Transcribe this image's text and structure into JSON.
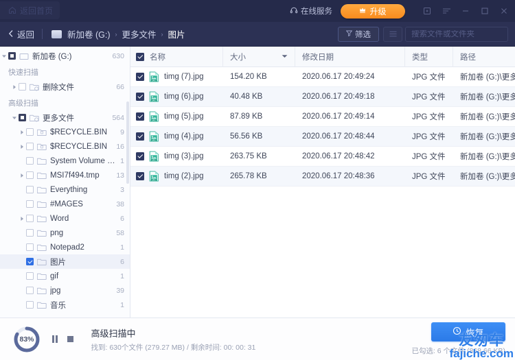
{
  "titlebar": {
    "home_label": "返回首页",
    "home_icon": "home-icon",
    "online_service_label": "在线服务",
    "online_service_icon": "headset-icon",
    "upgrade_label": "升级",
    "upgrade_icon": "crown-icon",
    "window_icons": [
      "feedback-icon",
      "menu-icon",
      "minimize-icon",
      "maximize-icon",
      "close-icon"
    ]
  },
  "breadcrumb": {
    "back_label": "返回",
    "back_icon": "chevron-left-icon",
    "drive_icon": "drive-icon",
    "items": [
      "新加卷 (G:)",
      "更多文件",
      "图片"
    ],
    "separator": "›"
  },
  "toolbar": {
    "filter_label": "筛选",
    "filter_icon": "funnel-icon",
    "view_icon": "list-view-icon",
    "search_placeholder": "搜索文件或文件夹",
    "search_value": "",
    "search_icon": "search-icon"
  },
  "sidebar": {
    "root": {
      "label": "新加卷 (G:)",
      "count": "630",
      "checkstate": "partial",
      "expanded": true
    },
    "groups": [
      {
        "title": "快速扫描",
        "items": [
          {
            "label": "删除文件",
            "count": "66",
            "checkstate": "none",
            "twisty": "collapsed",
            "indent": 1,
            "icon": "folder-deleted-icon"
          }
        ]
      },
      {
        "title": "高级扫描",
        "items": [
          {
            "label": "更多文件",
            "count": "564",
            "checkstate": "partial",
            "twisty": "expanded",
            "indent": 1,
            "icon": "folder-search-icon"
          },
          {
            "label": "$RECYCLE.BIN",
            "count": "9",
            "checkstate": "none",
            "twisty": "collapsed",
            "indent": 2,
            "icon": "folder-recycle-icon"
          },
          {
            "label": "$RECYCLE.BIN",
            "count": "16",
            "checkstate": "none",
            "twisty": "collapsed",
            "indent": 2,
            "icon": "folder-recycle-icon"
          },
          {
            "label": "System Volume Inf...",
            "count": "1",
            "checkstate": "none",
            "twisty": "none",
            "indent": 2,
            "icon": "folder-icon"
          },
          {
            "label": "MSI7f494.tmp",
            "count": "13",
            "checkstate": "none",
            "twisty": "collapsed",
            "indent": 2,
            "icon": "folder-icon"
          },
          {
            "label": "Everything",
            "count": "3",
            "checkstate": "none",
            "twisty": "none",
            "indent": 2,
            "icon": "folder-icon"
          },
          {
            "label": "#MAGES",
            "count": "38",
            "checkstate": "none",
            "twisty": "none",
            "indent": 2,
            "icon": "folder-icon"
          },
          {
            "label": "Word",
            "count": "6",
            "checkstate": "none",
            "twisty": "collapsed",
            "indent": 2,
            "icon": "folder-icon"
          },
          {
            "label": "png",
            "count": "58",
            "checkstate": "none",
            "twisty": "none",
            "indent": 2,
            "icon": "folder-icon"
          },
          {
            "label": "Notepad2",
            "count": "1",
            "checkstate": "none",
            "twisty": "none",
            "indent": 2,
            "icon": "folder-icon"
          },
          {
            "label": "图片",
            "count": "6",
            "checkstate": "checked",
            "twisty": "none",
            "indent": 2,
            "icon": "folder-icon",
            "selected": true
          },
          {
            "label": "gif",
            "count": "1",
            "checkstate": "none",
            "twisty": "none",
            "indent": 2,
            "icon": "folder-icon"
          },
          {
            "label": "jpg",
            "count": "39",
            "checkstate": "none",
            "twisty": "none",
            "indent": 2,
            "icon": "folder-icon"
          },
          {
            "label": "音乐",
            "count": "1",
            "checkstate": "none",
            "twisty": "none",
            "indent": 2,
            "icon": "folder-icon"
          }
        ]
      }
    ]
  },
  "table": {
    "columns": [
      "名称",
      "大小",
      "修改日期",
      "类型",
      "路径"
    ],
    "sort_column": "大小",
    "sort_icon": "caret-down-icon",
    "header_checked": true,
    "rows": [
      {
        "name": "timg (7).jpg",
        "size": "154.20 KB",
        "date": "2020.06.17 20:49:24",
        "type": "JPG 文件",
        "path": "新加卷 (G:)\\更多文件...",
        "checked": true
      },
      {
        "name": "timg (6).jpg",
        "size": "40.48 KB",
        "date": "2020.06.17 20:49:18",
        "type": "JPG 文件",
        "path": "新加卷 (G:)\\更多文件...",
        "checked": true
      },
      {
        "name": "timg (5).jpg",
        "size": "87.89 KB",
        "date": "2020.06.17 20:49:14",
        "type": "JPG 文件",
        "path": "新加卷 (G:)\\更多文件...",
        "checked": true
      },
      {
        "name": "timg (4).jpg",
        "size": "56.56 KB",
        "date": "2020.06.17 20:48:44",
        "type": "JPG 文件",
        "path": "新加卷 (G:)\\更多文件...",
        "checked": true
      },
      {
        "name": "timg (3).jpg",
        "size": "263.75 KB",
        "date": "2020.06.17 20:48:42",
        "type": "JPG 文件",
        "path": "新加卷 (G:)\\更多文件...",
        "checked": true
      },
      {
        "name": "timg (2).jpg",
        "size": "265.78 KB",
        "date": "2020.06.17 20:48:36",
        "type": "JPG 文件",
        "path": "新加卷 (G:)\\更多文件...",
        "checked": true
      }
    ]
  },
  "footer": {
    "progress_percent": 83,
    "progress_label": "83%",
    "pause_icon": "pause-icon",
    "stop_icon": "stop-icon",
    "scan_title": "高级扫描中",
    "scan_detail": "找到: 630个文件 (279.27 MB) / 剩余时间:  00: 00: 31",
    "recover_label": "恢复",
    "recover_icon": "restore-clock-icon",
    "selected_label": "已勾选: 6 个文件 (868.66 KB)"
  },
  "watermark": {
    "cn": "友匆车",
    "en": "fajiche.com"
  },
  "colors": {
    "titlebar_bg": "#252a4a",
    "crumbbar_bg": "#2c3154",
    "accent_orange": "#f98b1e",
    "accent_blue": "#2b7ae8",
    "checkbox_dark": "#2f3a63",
    "sidebar_bg": "#fbfcfe",
    "row_alt": "#f4f7fc"
  }
}
